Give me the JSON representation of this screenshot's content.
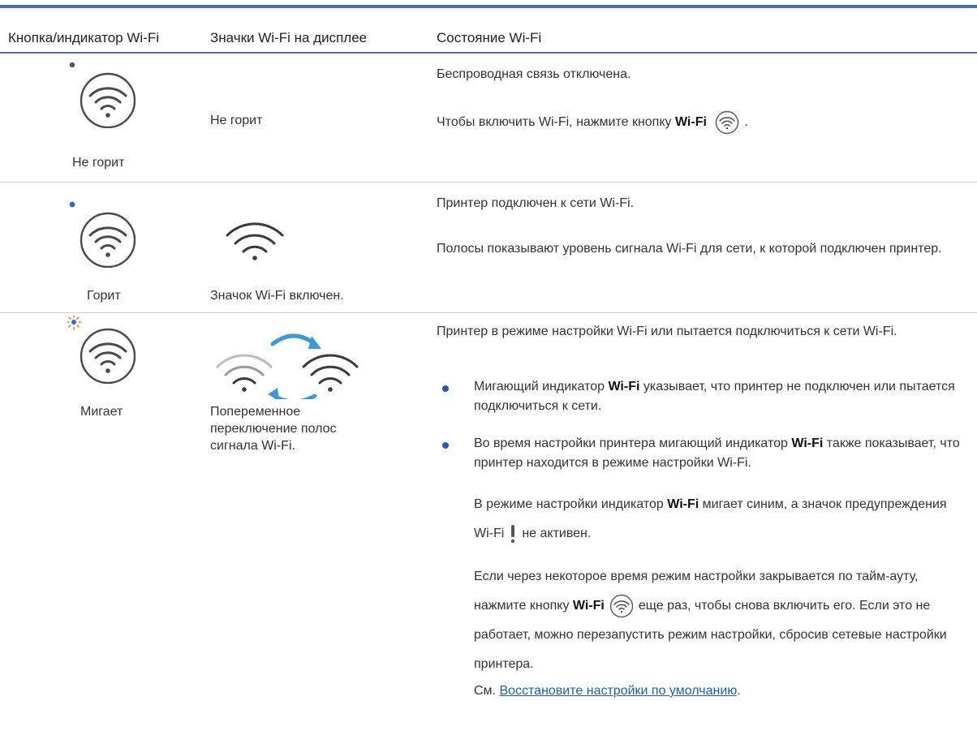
{
  "header": {
    "col1": "Кнопка/индикатор Wi-Fi",
    "col2": "Значки Wi-Fi на дисплее",
    "col3": "Состояние Wi-Fi"
  },
  "rows": [
    {
      "button_caption": "Не горит",
      "display_text": "Не горит",
      "p1": "Беспроводная связь отключена.",
      "p2_prefix": "Чтобы включить Wi-Fi, нажмите кнопку ",
      "p2_bold": "Wi-Fi",
      "p2_suffix": "."
    },
    {
      "button_caption": "Горит",
      "display_caption": "Значок Wi-Fi включен.",
      "p1": "Принтер подключен к сети Wi-Fi.",
      "p2": "Полосы показывают уровень сигнала Wi-Fi для сети, к которой подключен принтер."
    },
    {
      "button_caption": "Мигает",
      "display_caption": "Попеременное переключение полос сигнала Wi-Fi.",
      "p1": "Принтер в режиме настройки Wi-Fi или пытается подключиться к сети Wi-Fi.",
      "b1_prefix": "Мигающий индикатор ",
      "b1_bold": "Wi-Fi",
      "b1_suffix": " указывает, что принтер не подключен или пытается подключиться к сети.",
      "b2_prefix": "Во время настройки принтера мигающий индикатор ",
      "b2_bold": "Wi-Fi",
      "b2_suffix": " также показывает, что принтер находится в режиме настройки Wi-Fi.",
      "s1_prefix": "В режиме настройки индикатор ",
      "s1_bold": "Wi-Fi",
      "s1_mid": " мигает синим, а значок предупреждения Wi-Fi",
      "s1_suffix": "не активен.",
      "s2_prefix": "Если через некоторое время режим настройки закрывается по тайм-ауту, нажмите кнопку ",
      "s2_bold": "Wi-Fi",
      "s2_suffix": "еще раз, чтобы снова включить его. Если это не работает, можно перезапустить режим настройки, сбросив сетевые настройки принтера.",
      "see_prefix": "См. ",
      "see_link": "Восстановите настройки по умолчанию",
      "see_suffix": "."
    }
  ],
  "colors": {
    "rule": "#4a6fa5",
    "indicator_on": "#1e6fd9",
    "indicator_off": "#555555",
    "blink_star": "#f28c28",
    "arrow": "#3a9ad9",
    "link": "#1a5fb4"
  }
}
